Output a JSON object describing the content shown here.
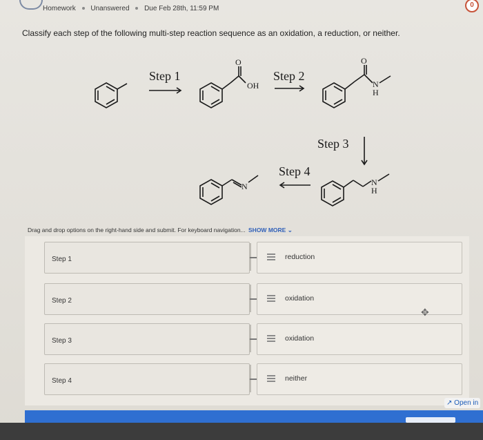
{
  "header": {
    "breadcrumb": [
      "Homework",
      "Unanswered",
      "Due Feb 28th, 11:59 PM"
    ]
  },
  "question": {
    "text": "Classify each step of the following multi-step reaction sequence as an oxidation, a reduction, or neither."
  },
  "scheme": {
    "step_labels": [
      "Step 1",
      "Step 2",
      "Step 3",
      "Step 4"
    ],
    "atom_labels": {
      "o1": "O",
      "oh": "OH",
      "o2": "O",
      "n2": "N",
      "h2": "H",
      "n3": "N",
      "h3": "H",
      "n4": "N"
    }
  },
  "instructions": {
    "text": "Drag and drop options on the right-hand side and submit. For keyboard navigation...",
    "show_more": "SHOW MORE"
  },
  "matching": {
    "rows": [
      {
        "step": "Step 1",
        "answer": "reduction"
      },
      {
        "step": "Step 2",
        "answer": "oxidation"
      },
      {
        "step": "Step 3",
        "answer": "oxidation"
      },
      {
        "step": "Step 4",
        "answer": "neither"
      }
    ]
  },
  "footer": {
    "open_in": "Open in"
  },
  "icons": {
    "drag_handle": "drag-handle-icon",
    "move": "move-icon",
    "expand": "expand-icon",
    "chevron": "chevron-down-icon"
  },
  "colors": {
    "accent_blue": "#2f6fd1",
    "link_blue": "#2f5fb8",
    "background": "#e8e6e1"
  }
}
